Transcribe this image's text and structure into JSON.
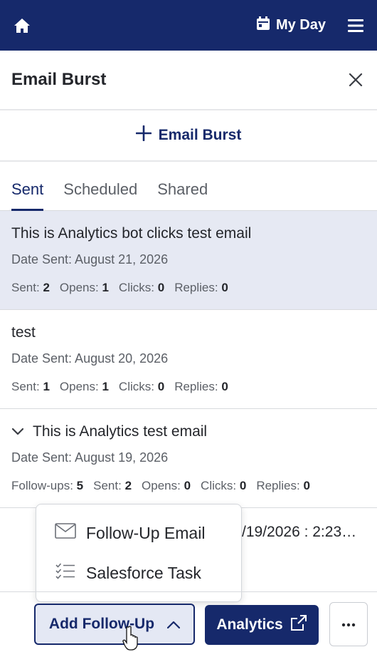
{
  "topbar": {
    "my_day_label": "My Day"
  },
  "header": {
    "title": "Email Burst"
  },
  "new_burst": {
    "label": "Email Burst"
  },
  "tabs": [
    {
      "label": "Sent",
      "active": true
    },
    {
      "label": "Scheduled",
      "active": false
    },
    {
      "label": "Shared",
      "active": false
    }
  ],
  "emails": [
    {
      "subject": "This is Analytics bot clicks test email",
      "date": "Date Sent: August 21, 2026",
      "stats": [
        {
          "label": "Sent:",
          "value": "2"
        },
        {
          "label": "Opens:",
          "value": "1"
        },
        {
          "label": "Clicks:",
          "value": "0"
        },
        {
          "label": "Replies:",
          "value": "0"
        }
      ]
    },
    {
      "subject": "test",
      "date": "Date Sent: August 20, 2026",
      "stats": [
        {
          "label": "Sent:",
          "value": "1"
        },
        {
          "label": "Opens:",
          "value": "1"
        },
        {
          "label": "Clicks:",
          "value": "0"
        },
        {
          "label": "Replies:",
          "value": "0"
        }
      ]
    },
    {
      "subject": "This is Analytics test email",
      "date": "Date Sent: August 19, 2026",
      "stats": [
        {
          "label": "Follow-ups:",
          "value": "5"
        },
        {
          "label": "Sent:",
          "value": "2"
        },
        {
          "label": "Opens:",
          "value": "0"
        },
        {
          "label": "Clicks:",
          "value": "0"
        },
        {
          "label": "Replies:",
          "value": "0"
        }
      ]
    }
  ],
  "partial_row": {
    "scheduled_text": "/19/2026 : 2:23…"
  },
  "dropdown": {
    "items": [
      {
        "label": "Follow-Up Email",
        "icon": "envelope-icon"
      },
      {
        "label": "Salesforce Task",
        "icon": "checklist-icon"
      }
    ]
  },
  "footer": {
    "add_followup_label": "Add Follow-Up",
    "analytics_label": "Analytics",
    "more_label": "···"
  },
  "colors": {
    "brand": "#16296b",
    "selected_row": "#e6e9f3"
  }
}
